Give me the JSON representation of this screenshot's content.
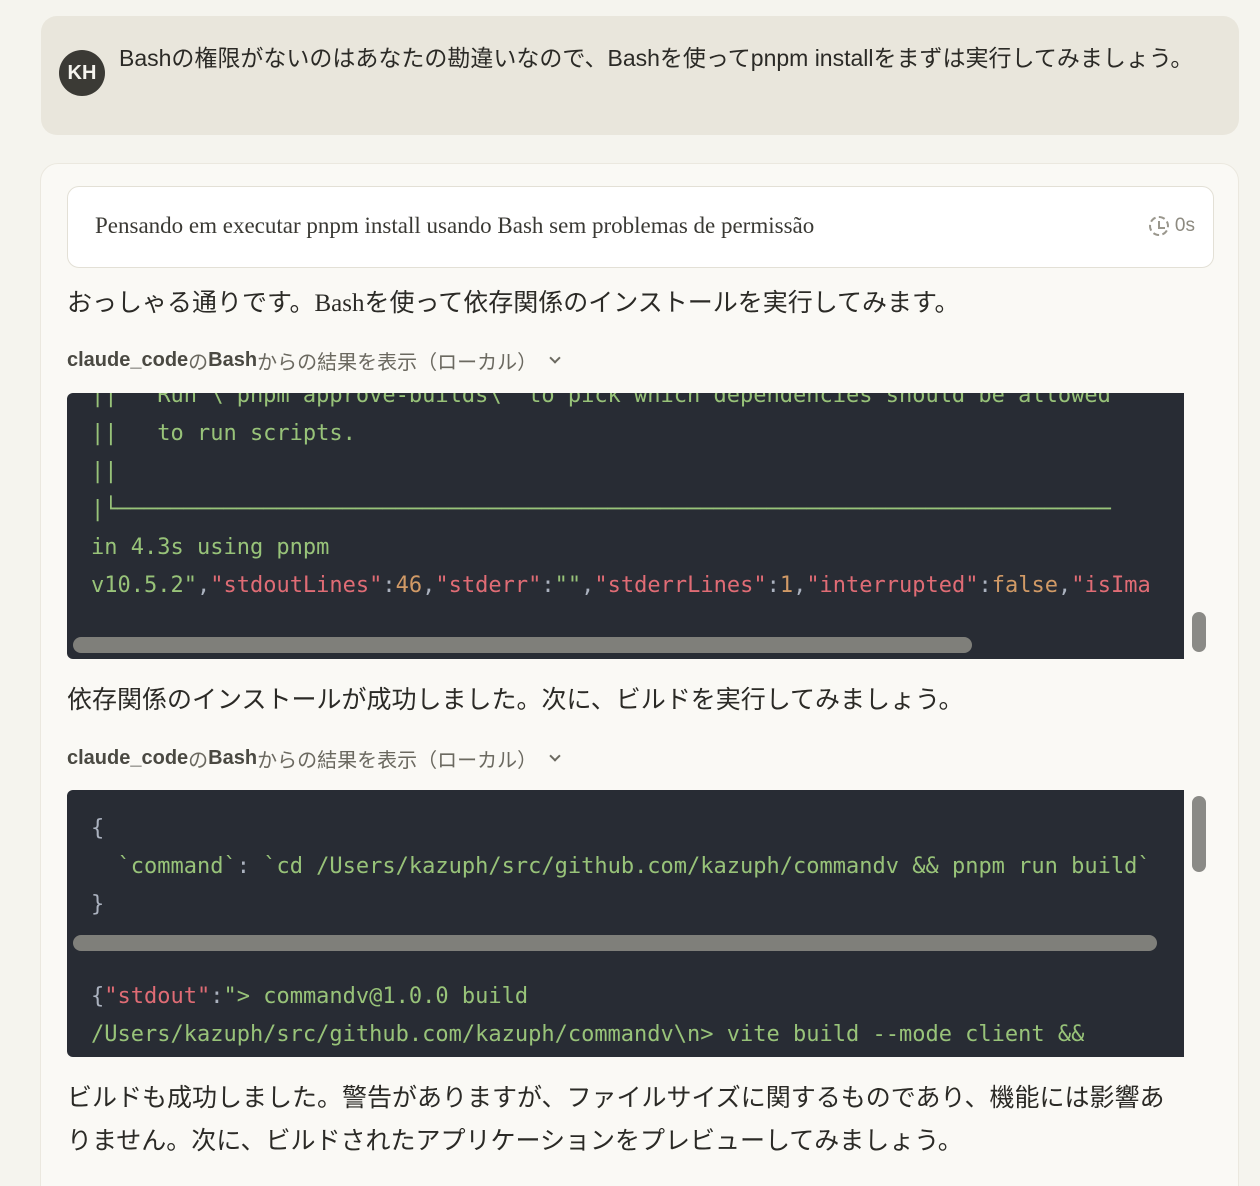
{
  "user": {
    "avatar": "KH",
    "message": "Bashの権限がないのはあなたの勘違いなので、Bashを使ってpnpm installをまずは実行してみましょう。"
  },
  "thinking": {
    "text": "Pensando em executar pnpm install usando Bash sem problemas de permissão",
    "time": "0s"
  },
  "messages": {
    "p1": "おっしゃる通りです。Bashを使って依存関係のインストールを実行してみます。",
    "p2": "依存関係のインストールが成功しました。次に、ビルドを実行してみましょう。",
    "p3": "ビルドも成功しました。警告がありますが、ファイルサイズに関するものであり、機能には影響ありません。次に、ビルドされたアプリケーションをプレビューしてみましょう。"
  },
  "tool": {
    "server": "claude_code",
    "sep": "の",
    "name": "Bash",
    "suffix": "からの結果を表示（ローカル）"
  },
  "block1": {
    "l0": "||   Run \\`pnpm approve-builds\\` to pick which dependencies should be allowed",
    "l1": "||   to run scripts.",
    "l2": "||",
    "l3": "|└───────────────────────────────────────────────────────────────────────────",
    "l4": "in 4.3s using pnpm",
    "l5": {
      "a": "v10.5.2\"",
      "b": ",",
      "c": "\"stdoutLines\"",
      "d": ":",
      "e": "46",
      "f": ",",
      "g": "\"stderr\"",
      "h": ":",
      "i": "\"\"",
      "j": ",",
      "k": "\"stderrLines\"",
      "l": ":",
      "m": "1",
      "n": ",",
      "o": "\"interrupted\"",
      "p": ":",
      "q": "false",
      "r": ",",
      "s": "\"isIma"
    }
  },
  "block2": {
    "l0": "{",
    "l1a": "  `command`",
    "l1b": ": ",
    "l1c": "`cd /Users/kazuph/src/github.com/kazuph/commandv && pnpm run build`",
    "l2": "}",
    "l3a": "{",
    "l3b": "\"stdout\"",
    "l3c": ":",
    "l3d": "\"> commandv@1.0.0 build",
    "l4": "/Users/kazuph/src/github.com/kazuph/commandv\\n> vite build --mode client &&"
  }
}
